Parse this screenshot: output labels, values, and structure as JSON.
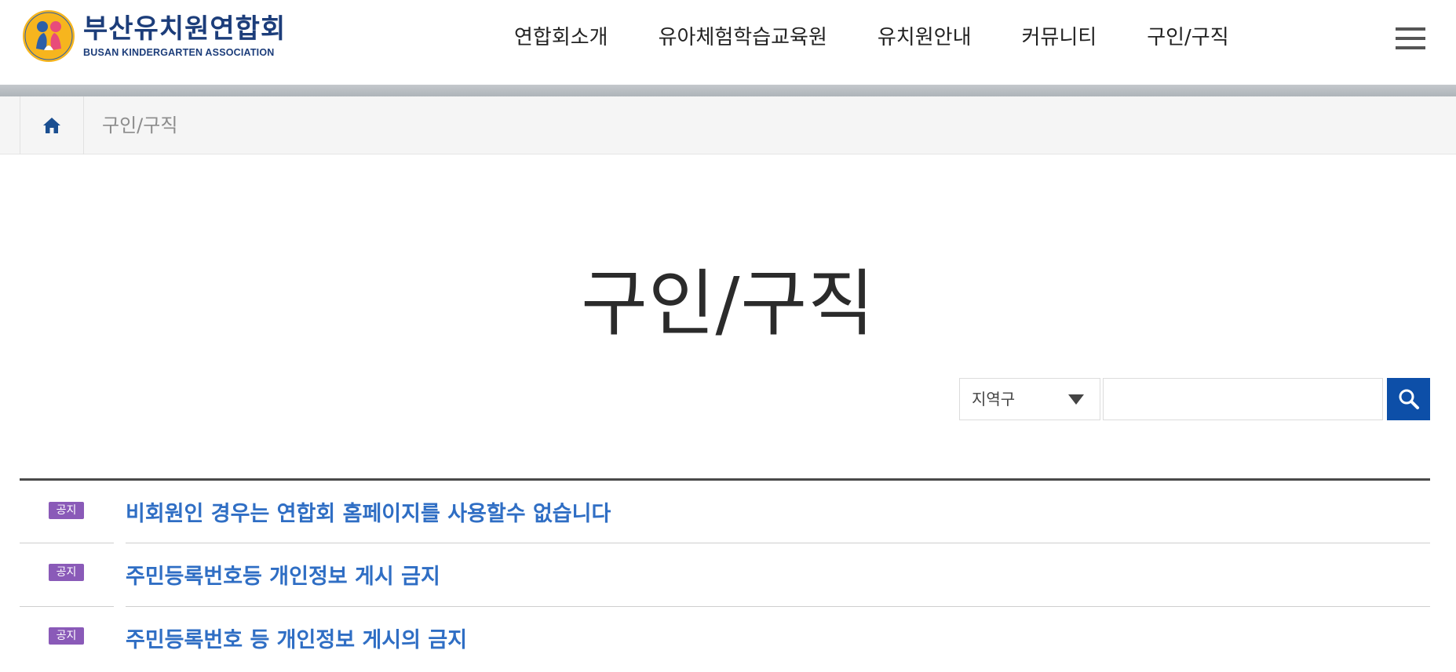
{
  "logo": {
    "name_ko": "부산유치원연합회",
    "name_en": "BUSAN KINDERGARTEN ASSOCIATION"
  },
  "gnb": {
    "items": [
      "연합회소개",
      "유아체험학습교육원",
      "유치원안내",
      "커뮤니티",
      "구인/구직"
    ]
  },
  "breadcrumb": {
    "current": "구인/구직"
  },
  "page": {
    "title": "구인/구직"
  },
  "search": {
    "select_value": "지역구",
    "input_value": ""
  },
  "notices": [
    {
      "badge": "공지",
      "title": "비회원인 경우는 연합회 홈페이지를 사용할수 없습니다"
    },
    {
      "badge": "공지",
      "title": "주민등록번호등 개인정보 게시 금지"
    },
    {
      "badge": "공지",
      "title": "주민등록번호 등 개인정보 게시의 금지"
    }
  ],
  "colors": {
    "brand": "#1c3d7a",
    "search_button": "#0d4fa8",
    "notice_title": "#2f6ec4",
    "badge": "#8a5ab8"
  },
  "icons": {
    "home": "home-icon",
    "search": "search-icon",
    "menu": "hamburger-menu-icon"
  }
}
